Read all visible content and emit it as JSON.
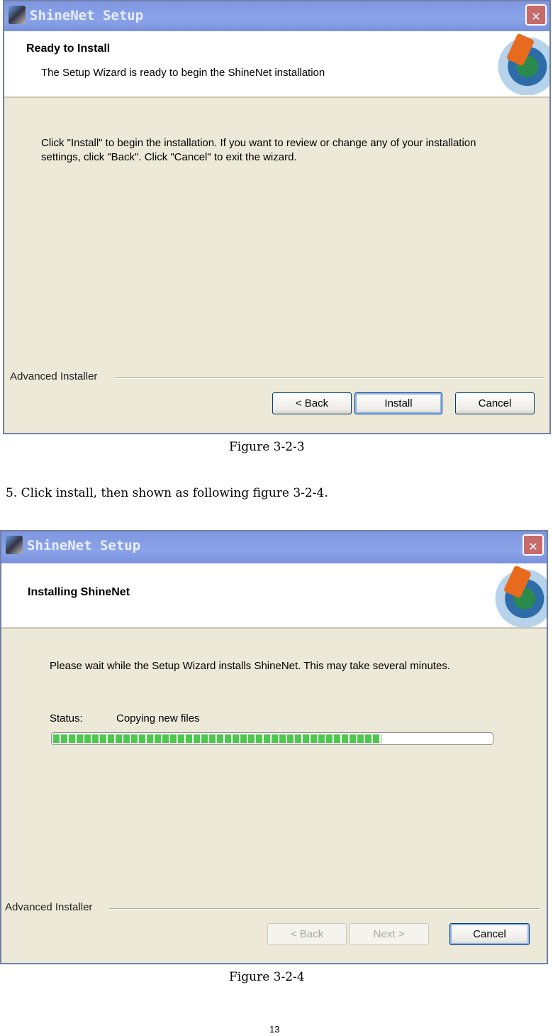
{
  "dialog1": {
    "title": "ShineNet Setup",
    "heading": "Ready to Install",
    "subheading": "The Setup Wizard is ready to begin the ShineNet installation",
    "body": "Click \"Install\" to begin the installation.  If you want to review or change any of your installation settings, click \"Back\".  Click \"Cancel\" to exit the wizard.",
    "footer_label": "Advanced Installer",
    "buttons": {
      "back": "< Back",
      "install": "Install",
      "cancel": "Cancel"
    }
  },
  "caption1": "Figure 3-2-3",
  "instruction": "5. Click install, then shown as following figure 3-2-4.",
  "dialog2": {
    "title": "ShineNet Setup",
    "heading": "Installing ShineNet",
    "body": "Please wait while the Setup Wizard installs ShineNet.  This may take several minutes.",
    "status_label": "Status:",
    "status_value": "Copying new files",
    "progress_percent": 75,
    "progress_color": "#4cc84c",
    "footer_label": "Advanced Installer",
    "buttons": {
      "back": "< Back",
      "next": "Next >",
      "cancel": "Cancel"
    }
  },
  "caption2": "Figure 3-2-4",
  "page_number": "13"
}
